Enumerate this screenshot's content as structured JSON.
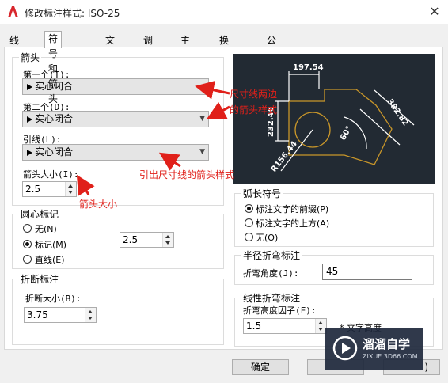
{
  "window": {
    "title": "修改标注样式: ISO-25",
    "close": "✕"
  },
  "tabs": [
    "线",
    "符号和箭头",
    "文字",
    "调整",
    "主单位",
    "换算单位",
    "公差"
  ],
  "arrows": {
    "group_title": "箭头",
    "first_label": "第一个(T):",
    "first_value": "实心闭合",
    "second_label": "第二个(D):",
    "second_value": "实心闭合",
    "leader_label": "引线(L):",
    "leader_value": "实心闭合",
    "size_label": "箭头大小(I):",
    "size_value": "2.5"
  },
  "center_mark": {
    "group_title": "圆心标记",
    "opt_none": "无(N)",
    "opt_mark": "标记(M)",
    "opt_line": "直线(E)",
    "selected": "mark",
    "size_value": "2.5"
  },
  "break": {
    "group_title": "折断标注",
    "size_label": "折断大小(B):",
    "size_value": "3.75"
  },
  "arc_length": {
    "group_title": "弧长符号",
    "opt_prefix": "标注文字的前缀(P)",
    "opt_above": "标注文字的上方(A)",
    "opt_none": "无(O)",
    "selected": "prefix"
  },
  "radius_jog": {
    "group_title": "半径折弯标注",
    "angle_label": "折弯角度(J):",
    "angle_value": "45"
  },
  "linear_jog": {
    "group_title": "线性折弯标注",
    "height_label": "折弯高度因子(F):",
    "height_value": "1.5",
    "suffix": "* 文字高度"
  },
  "preview": {
    "dim1": "197.54",
    "dim2": "232.46",
    "dim3": "382.82",
    "dim4": "60°",
    "dim5": "R156.44"
  },
  "annotations": {
    "a1": "尺寸线两边",
    "a2": "的箭头样式",
    "a3": "引出尺寸线的箭头样式",
    "a4": "箭头大小"
  },
  "buttons": {
    "ok": "确定",
    "cancel_fragment": ")"
  },
  "watermark": {
    "brand": "溜溜自学",
    "site": "ZIXUE.3D66.COM"
  }
}
